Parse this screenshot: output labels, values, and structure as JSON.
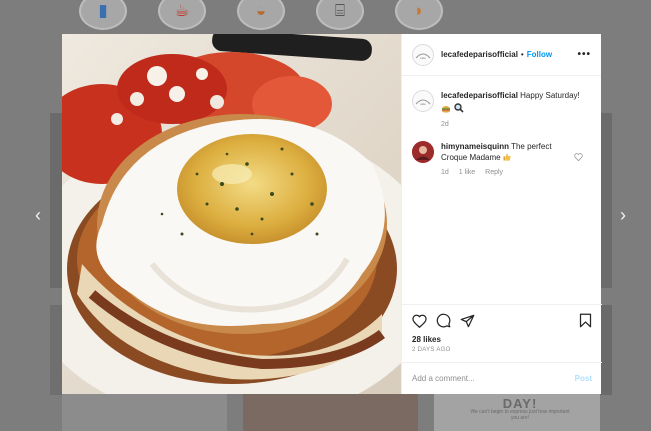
{
  "background": {
    "highlight_icons": [
      "phone-booth-icon",
      "coffee-cup-icon",
      "bread-icon",
      "cafe-table-icon",
      "croissant-icon"
    ],
    "tile_title": "DAY!",
    "tile_subtitle": "We can't begin to express just how important you are!",
    "prev_label": "‹",
    "next_label": "›"
  },
  "post": {
    "image": "croque-madame-photo",
    "header": {
      "username": "lecafedeparisofficial",
      "separator": "•",
      "follow_label": "Follow",
      "more_label": "•••"
    },
    "caption": {
      "username": "lecafedeparisofficial",
      "text": "Happy Saturday!",
      "emojis": [
        "sandwich-emoji",
        "magnifier-emoji"
      ],
      "time": "2d"
    },
    "comments": [
      {
        "username": "himynameisquinn",
        "text": "The perfect Croque Madame",
        "emoji": "thumbs-up-emoji",
        "time": "1d",
        "likes": "1 like",
        "reply_label": "Reply"
      }
    ],
    "likes": "28 likes",
    "date": "2 DAYS AGO",
    "add_comment_placeholder": "Add a comment...",
    "post_label": "Post"
  },
  "colors": {
    "link_blue": "#0095f6",
    "post_disabled": "#b2dffc",
    "muted_text": "#8e8e8e"
  }
}
